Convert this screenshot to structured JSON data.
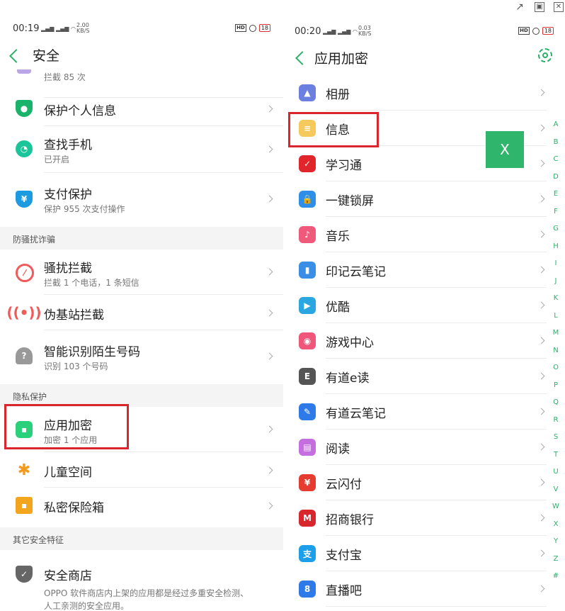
{
  "window_buttons": {
    "popout": "↗",
    "maximize": "▣",
    "close": "✕"
  },
  "left": {
    "status": {
      "time": "00:19",
      "speed": "2.00\nKB/S",
      "battery": "18"
    },
    "nav": {
      "title": "安全"
    },
    "partial": {
      "sub": "拦截 85 次"
    },
    "items": [
      {
        "title": "保护个人信息",
        "icon": "person-shield-icon",
        "color": "#19b36b"
      },
      {
        "title": "查找手机",
        "sub": "已开启",
        "icon": "find-phone-icon",
        "color": "#1bc59a"
      },
      {
        "title": "支付保护",
        "sub": "保护 955 次支付操作",
        "icon": "yen-shield-icon",
        "color": "#1d9be0"
      }
    ],
    "section1": "防骚扰诈骗",
    "items2": [
      {
        "title": "骚扰拦截",
        "sub": "拦截 1 个电话，1 条短信",
        "icon": "block-icon",
        "color": "#f05a5a"
      },
      {
        "title": "伪基站拦截",
        "icon": "tower-icon",
        "color": "#f05a5a"
      },
      {
        "title": "智能识别陌生号码",
        "sub": "识别 103 个号码",
        "icon": "unknown-person-icon",
        "color": "#888"
      }
    ],
    "section2": "隐私保护",
    "items3": [
      {
        "title": "应用加密",
        "sub": "加密 1 个应用",
        "icon": "lock-icon",
        "color": "#2bd07a"
      },
      {
        "title": "儿童空间",
        "icon": "child-icon",
        "color": "#f39a1e"
      },
      {
        "title": "私密保险箱",
        "icon": "safe-folder-icon",
        "color": "#f3a51e"
      }
    ],
    "section3": "其它安全特征",
    "store": {
      "title": "安全商店",
      "desc1": "OPPO 软件商店内上架的应用都是经过多重安全检测、",
      "desc2": "人工亲测的安全应用。",
      "icon": "shield-check-icon"
    }
  },
  "right": {
    "status": {
      "time": "00:20",
      "speed": "0.03\nKB/S",
      "battery": "18"
    },
    "nav": {
      "title": "应用加密"
    },
    "apps": [
      {
        "title": "相册",
        "icon": "gallery-icon",
        "color": "#6b7fe0",
        "glyph": "▲"
      },
      {
        "title": "信息",
        "icon": "message-icon",
        "color": "#f5c95b",
        "glyph": "≡"
      },
      {
        "title": "学习通",
        "icon": "xuexitong-icon",
        "color": "#e0262b",
        "glyph": "✓"
      },
      {
        "title": "一键锁屏",
        "icon": "lockscreen-icon",
        "color": "#2d8fe8",
        "glyph": "🔒"
      },
      {
        "title": "音乐",
        "icon": "music-icon",
        "color": "#f05a7a",
        "glyph": "♪"
      },
      {
        "title": "印记云笔记",
        "icon": "yinji-icon",
        "color": "#3a8ee6",
        "glyph": "▮"
      },
      {
        "title": "优酷",
        "icon": "youku-icon",
        "color": "#2aa7e0",
        "glyph": "▶"
      },
      {
        "title": "游戏中心",
        "icon": "game-icon",
        "color": "#f0557a",
        "glyph": "◉"
      },
      {
        "title": "有道e读",
        "icon": "youdao-eread-icon",
        "color": "#555",
        "glyph": "E"
      },
      {
        "title": "有道云笔记",
        "icon": "youdao-note-icon",
        "color": "#2d7ae8",
        "glyph": "✎"
      },
      {
        "title": "阅读",
        "icon": "reader-icon",
        "color": "#c56ee0",
        "glyph": "▤"
      },
      {
        "title": "云闪付",
        "icon": "unionpay-icon",
        "color": "#e53c2f",
        "glyph": "¥"
      },
      {
        "title": "招商银行",
        "icon": "cmb-icon",
        "color": "#d8262d",
        "glyph": "M"
      },
      {
        "title": "支付宝",
        "icon": "alipay-icon",
        "color": "#1d9ee8",
        "glyph": "支"
      },
      {
        "title": "直播吧",
        "icon": "zhiboba-icon",
        "color": "#2d7ae8",
        "glyph": "8"
      }
    ],
    "alphabet": [
      "A",
      "B",
      "C",
      "D",
      "E",
      "F",
      "G",
      "H",
      "I",
      "J",
      "K",
      "L",
      "M",
      "N",
      "O",
      "P",
      "Q",
      "R",
      "S",
      "T",
      "U",
      "V",
      "W",
      "X",
      "Y",
      "Z",
      "#"
    ],
    "overlay_button": "X"
  }
}
